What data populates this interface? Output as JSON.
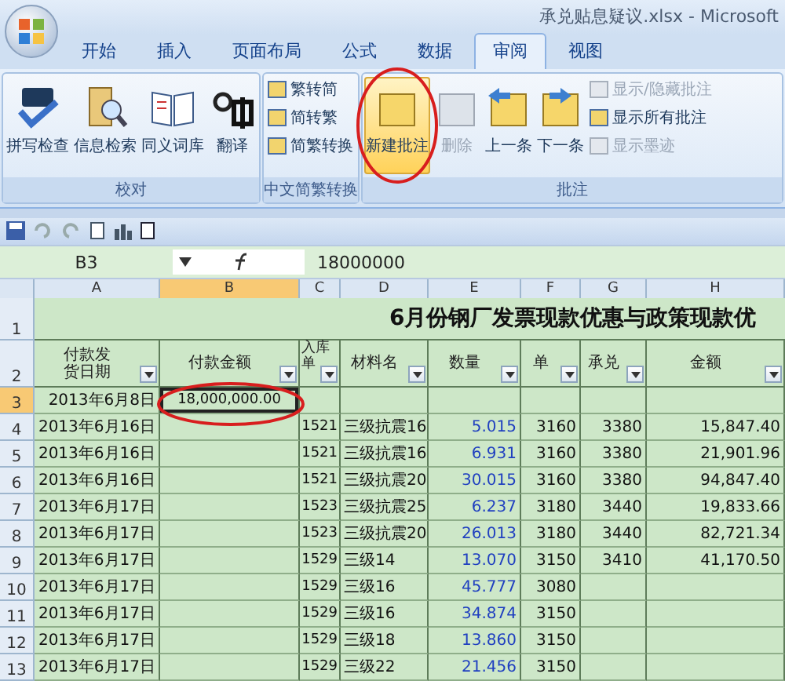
{
  "window": {
    "title": "承兑贴息疑议.xlsx - Microsoft"
  },
  "ribbon_tabs": [
    {
      "label": "开始",
      "selected": false
    },
    {
      "label": "插入",
      "selected": false
    },
    {
      "label": "页面布局",
      "selected": false
    },
    {
      "label": "公式",
      "selected": false
    },
    {
      "label": "数据",
      "selected": false
    },
    {
      "label": "审阅",
      "selected": true
    },
    {
      "label": "视图",
      "selected": false
    }
  ],
  "ribbon_groups": [
    {
      "label": "校对",
      "buttons": [
        {
          "kind": "large",
          "label": "拼写检查",
          "disabled": false,
          "highlighted": false
        },
        {
          "kind": "large",
          "label": "信息检索",
          "disabled": false,
          "highlighted": false
        },
        {
          "kind": "large",
          "label": "同义词库",
          "disabled": false,
          "highlighted": false
        },
        {
          "kind": "large",
          "label": "翻译",
          "disabled": false,
          "highlighted": false
        }
      ]
    },
    {
      "label": "中文简繁转换",
      "buttons": [
        {
          "kind": "small",
          "label": "繁转简",
          "disabled": false,
          "highlighted": false
        },
        {
          "kind": "small",
          "label": "简转繁",
          "disabled": false,
          "highlighted": false
        },
        {
          "kind": "small",
          "label": "简繁转换",
          "disabled": false,
          "highlighted": false
        }
      ]
    },
    {
      "label": "批注",
      "buttons": [
        {
          "kind": "large",
          "label": "新建批注",
          "disabled": false,
          "highlighted": true
        },
        {
          "kind": "large",
          "label": "删除",
          "disabled": true,
          "highlighted": false
        },
        {
          "kind": "large",
          "label": "上一条",
          "disabled": false,
          "highlighted": false
        },
        {
          "kind": "large",
          "label": "下一条",
          "disabled": false,
          "highlighted": false
        },
        {
          "kind": "small",
          "label": "显示/隐藏批注",
          "disabled": true,
          "highlighted": false
        },
        {
          "kind": "small",
          "label": "显示所有批注",
          "disabled": false,
          "highlighted": false
        },
        {
          "kind": "small",
          "label": "显示墨迹",
          "disabled": true,
          "highlighted": false
        }
      ]
    }
  ],
  "formula_bar": {
    "name_box": "B3",
    "value": "18000000"
  },
  "sheet": {
    "columns": [
      {
        "label": "A",
        "selected": false
      },
      {
        "label": "B",
        "selected": true
      },
      {
        "label": "C",
        "selected": false
      },
      {
        "label": "D",
        "selected": false
      },
      {
        "label": "E",
        "selected": false
      },
      {
        "label": "F",
        "selected": false
      },
      {
        "label": "G",
        "selected": false
      },
      {
        "label": "H",
        "selected": false
      }
    ],
    "title_row": {
      "number": "1",
      "title": "6月份钢厂发票现款优惠与政策现款优"
    },
    "header_row": {
      "number": "2",
      "headers": [
        "付款发货日期",
        "付款金额",
        "入库单",
        "材料名",
        "数量",
        "单",
        "承兑",
        "金额"
      ]
    },
    "rows": [
      {
        "number": "3",
        "selected": true,
        "cells": {
          "A": "2013年6月8日",
          "B": "18,000,000.00"
        }
      },
      {
        "number": "4",
        "selected": false,
        "cells": {
          "A": "2013年6月16日",
          "C": "1521",
          "D": "三级抗震16",
          "E": "5.015",
          "F": "3160",
          "G": "3380",
          "H": "15,847.40"
        }
      },
      {
        "number": "5",
        "selected": false,
        "cells": {
          "A": "2013年6月16日",
          "C": "1521",
          "D": "三级抗震16",
          "E": "6.931",
          "F": "3160",
          "G": "3380",
          "H": "21,901.96"
        }
      },
      {
        "number": "6",
        "selected": false,
        "cells": {
          "A": "2013年6月16日",
          "C": "1521",
          "D": "三级抗震20",
          "E": "30.015",
          "F": "3160",
          "G": "3380",
          "H": "94,847.40"
        }
      },
      {
        "number": "7",
        "selected": false,
        "cells": {
          "A": "2013年6月17日",
          "C": "1523",
          "D": "三级抗震25",
          "E": "6.237",
          "F": "3180",
          "G": "3440",
          "H": "19,833.66"
        }
      },
      {
        "number": "8",
        "selected": false,
        "cells": {
          "A": "2013年6月17日",
          "C": "1523",
          "D": "三级抗震20",
          "E": "26.013",
          "F": "3180",
          "G": "3440",
          "H": "82,721.34"
        }
      },
      {
        "number": "9",
        "selected": false,
        "cells": {
          "A": "2013年6月17日",
          "C": "1529",
          "D": "三级14",
          "E": "13.070",
          "F": "3150",
          "G": "3410",
          "H": "41,170.50"
        }
      },
      {
        "number": "10",
        "selected": false,
        "cells": {
          "A": "2013年6月17日",
          "C": "1529",
          "D": "三级16",
          "E": "45.777",
          "F": "3080"
        }
      },
      {
        "number": "11",
        "selected": false,
        "cells": {
          "A": "2013年6月17日",
          "C": "1529",
          "D": "三级16",
          "E": "34.874",
          "F": "3150"
        }
      },
      {
        "number": "12",
        "selected": false,
        "cells": {
          "A": "2013年6月17日",
          "C": "1529",
          "D": "三级18",
          "E": "13.860",
          "F": "3150"
        }
      },
      {
        "number": "13",
        "selected": false,
        "cells": {
          "A": "2013年6月17日",
          "C": "1529",
          "D": "三级22",
          "E": "21.456",
          "F": "3150"
        }
      }
    ]
  }
}
